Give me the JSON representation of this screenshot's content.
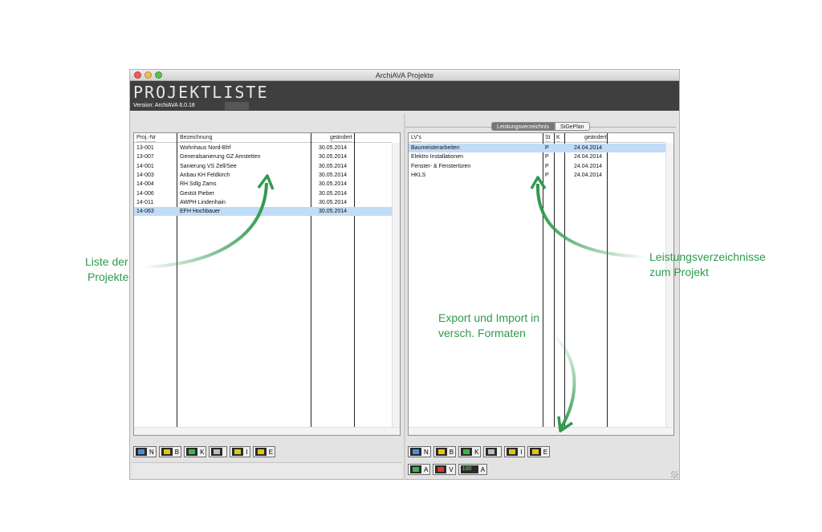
{
  "window": {
    "title": "ArchiAVA Projekte"
  },
  "header": {
    "title": "PROJEKTLISTE",
    "version": "Version:  ArchiAVA 6.0.18"
  },
  "projects": {
    "columns": [
      "Proj.-Nr",
      "Bezeichnung",
      "geändert"
    ],
    "rows": [
      {
        "nr": "13-001",
        "name": "Wohnhaus Nord-Bhf",
        "date": "30.05.2014"
      },
      {
        "nr": "13-007",
        "name": "Generalsanierung GZ Amstetten",
        "date": "30.05.2014"
      },
      {
        "nr": "14-001",
        "name": "Sanierung VS Zell/See",
        "date": "30.05.2014"
      },
      {
        "nr": "14-003",
        "name": "Anbau KH Feldkirch",
        "date": "30.05.2014"
      },
      {
        "nr": "14-004",
        "name": "RH Sdlg Zams",
        "date": "30.05.2014"
      },
      {
        "nr": "14-006",
        "name": "Gestüt Pieber",
        "date": "30.05.2014"
      },
      {
        "nr": "14-011",
        "name": "AWPH Lindenhain",
        "date": "30.05.2014"
      },
      {
        "nr": "14-063",
        "name": "EFH Hochbauer",
        "date": "30.05.2014"
      }
    ]
  },
  "tabs": {
    "active": "Leistungsverzeichnis",
    "inactive": "SiGePlan"
  },
  "lv": {
    "columns": [
      "LV's",
      "St",
      "K",
      "geändert"
    ],
    "rows": [
      {
        "name": "Baumeisterarbeiten",
        "st": "P",
        "k": "",
        "date": "24.04.2014"
      },
      {
        "name": "Elektro Installationen",
        "st": "P",
        "k": "",
        "date": "24.04.2014"
      },
      {
        "name": "Fenster- & Fenstertüren",
        "st": "P",
        "k": "",
        "date": "24.04.2014"
      },
      {
        "name": "HKLS",
        "st": "P",
        "k": "",
        "date": "24.04.2014"
      }
    ]
  },
  "toolbar_left": [
    {
      "icon": "new-project-icon",
      "label": "N"
    },
    {
      "icon": "edit-project-icon",
      "label": "B"
    },
    {
      "icon": "copy-project-icon",
      "label": "K"
    },
    {
      "icon": "trash-icon",
      "label": ""
    },
    {
      "icon": "import-icon",
      "label": "I"
    },
    {
      "icon": "export-icon",
      "label": "E"
    }
  ],
  "toolbar_right": [
    {
      "icon": "new-lv-icon",
      "label": "N"
    },
    {
      "icon": "edit-lv-icon",
      "label": "B"
    },
    {
      "icon": "copy-lv-icon",
      "label": "K"
    },
    {
      "icon": "trash-icon",
      "label": ""
    },
    {
      "icon": "import-icon",
      "label": "I"
    },
    {
      "icon": "export-icon",
      "label": "E"
    }
  ],
  "toolbar_right_bottom": [
    {
      "icon": "green-arrow-icon",
      "label": "A"
    },
    {
      "icon": "red-transfer-icon",
      "label": "V"
    },
    {
      "icon": "green-100-icon",
      "label": "A",
      "badge": "100"
    }
  ],
  "annotations": {
    "projects": [
      "Liste der",
      "Projekte"
    ],
    "lv": [
      "Leistungsverzeichnisse",
      "zum Projekt"
    ],
    "export": [
      "Export und Import in",
      "versch. Formaten"
    ]
  },
  "colors": {
    "accent": "#2f9a4e",
    "selection": "#c1dcf6",
    "header_bg": "#3f3f3f"
  }
}
